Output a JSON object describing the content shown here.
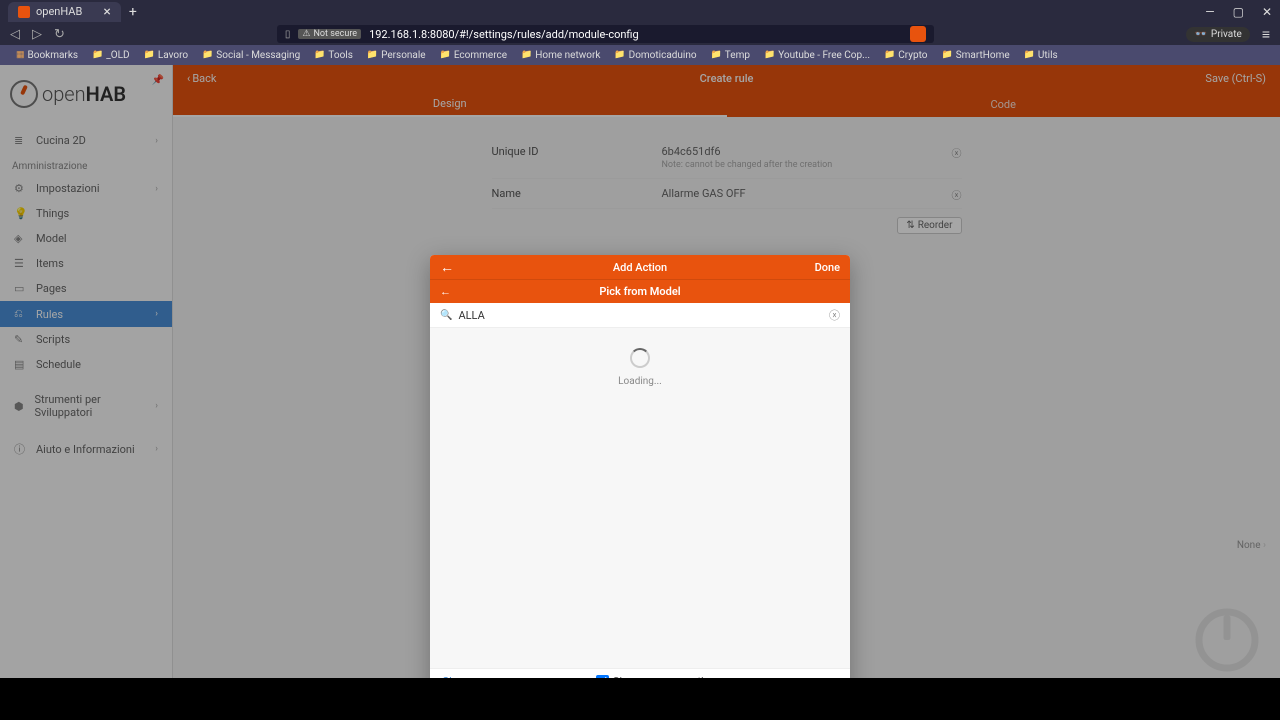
{
  "browser": {
    "tab_title": "openHAB",
    "url_security": "Not secure",
    "url": "192.168.1.8:8080/#!/settings/rules/add/module-config",
    "private_label": "Private"
  },
  "bookmarks": [
    "Bookmarks",
    "_OLD",
    "Lavoro",
    "Social - Messaging",
    "Tools",
    "Personale",
    "Ecommerce",
    "Home network",
    "Domoticaduino",
    "Temp",
    "Youtube - Free Cop...",
    "Crypto",
    "SmartHome",
    "Utils"
  ],
  "sidebar": {
    "brand_prefix": "open",
    "brand_suffix": "HAB",
    "top_item": "Cucina 2D",
    "section1": "Amministrazione",
    "items": [
      "Impostazioni",
      "Things",
      "Model",
      "Items",
      "Pages",
      "Rules",
      "Scripts",
      "Schedule"
    ],
    "dev_tools": "Strumenti per Sviluppatori",
    "help": "Aiuto e Informazioni"
  },
  "page": {
    "back": "Back",
    "title": "Create rule",
    "save": "Save (Ctrl-S)",
    "tab_design": "Design",
    "tab_code": "Code"
  },
  "form": {
    "uid_label": "Unique ID",
    "uid_value": "6b4c651df6",
    "uid_note": "Note: cannot be changed after the creation",
    "name_label": "Name",
    "name_value": "Allarme GAS OFF",
    "reorder": "Reorder",
    "none": "None"
  },
  "modal": {
    "header1_title": "Add Action",
    "done": "Done",
    "header2_title": "Pick from Model",
    "search_value": "ALLA",
    "loading": "Loading...",
    "clear": "Clear",
    "checkbox_label": "Show non-semantic"
  }
}
